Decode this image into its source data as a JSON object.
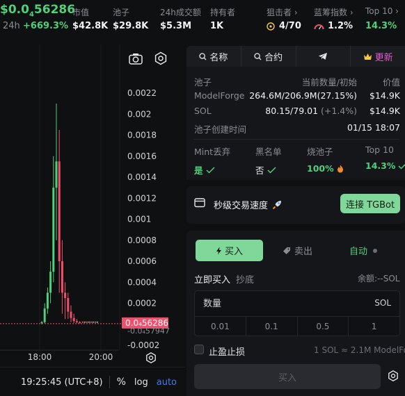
{
  "token": {
    "price_prefix": "$0.0",
    "price_sub": "4",
    "price_suffix": "56286",
    "change_label": "24h",
    "change_value": "+669.3%"
  },
  "stats": [
    {
      "label": "市值",
      "value": "$42.8K"
    },
    {
      "label": "池子",
      "value": "$29.8K"
    },
    {
      "label": "24h成交额",
      "value": "$5.3M"
    },
    {
      "label": "持有者",
      "value": "1K"
    },
    {
      "label": "狙击者",
      "value": "4/70"
    },
    {
      "label": "蓝筹指数",
      "value": "1.2%"
    },
    {
      "label": "Top 10",
      "value": "14.3%"
    }
  ],
  "chart": {
    "price_tag": "0.0₄56286",
    "price_tag_below": "-0.0₄57947",
    "time": "19:25:45 (UTC+8)",
    "percent_label": "%",
    "log_label": "log",
    "auto_label": "auto"
  },
  "chart_data": {
    "type": "candlestick",
    "yticks": [
      "0.0022",
      "0.002",
      "0.0018",
      "0.0016",
      "0.0014",
      "0.0012",
      "0.001",
      "0.0008",
      "0.0006",
      "0.0004",
      "0.0002",
      "-0.0002"
    ],
    "xticks": [
      "18:00",
      "20:00"
    ],
    "ylim": [
      -0.0002,
      0.0022
    ],
    "current_price": 5.6286e-06,
    "candles": [
      {
        "o": 1e-05,
        "h": 3e-05,
        "l": 0.0,
        "c": 2e-05
      },
      {
        "o": 2e-05,
        "h": 0.0002,
        "l": 1e-05,
        "c": 0.00015
      },
      {
        "o": 0.00015,
        "h": 0.00035,
        "l": 0.0001,
        "c": 0.0003
      },
      {
        "o": 0.0003,
        "h": 0.0006,
        "l": 0.0002,
        "c": 0.0005
      },
      {
        "o": 0.0005,
        "h": 0.0016,
        "l": 0.0004,
        "c": 0.0013
      },
      {
        "o": 0.0013,
        "h": 0.0021,
        "l": 0.0008,
        "c": 0.00155
      },
      {
        "o": 0.00155,
        "h": 0.00185,
        "l": 0.0003,
        "c": 0.0006
      },
      {
        "o": 0.0006,
        "h": 0.0008,
        "l": 0.0001,
        "c": 0.0003
      },
      {
        "o": 0.0003,
        "h": 0.0004,
        "l": 5e-05,
        "c": 0.00025
      },
      {
        "o": 0.00025,
        "h": 0.0003,
        "l": 5e-05,
        "c": 0.00012
      },
      {
        "o": 0.00012,
        "h": 0.00018,
        "l": 2e-05,
        "c": 6e-05
      },
      {
        "o": 6e-05,
        "h": 0.0001,
        "l": 1e-05,
        "c": 3e-05
      },
      {
        "o": 3e-05,
        "h": 5e-05,
        "l": 1e-05,
        "c": 2e-05
      },
      {
        "o": 2e-05,
        "h": 3e-05,
        "l": 1e-05,
        "c": 1e-05
      }
    ]
  },
  "tabs": {
    "name": "名称",
    "contract": "合约",
    "update": "更新"
  },
  "pool": {
    "header_pool": "池子",
    "header_amount": "当前数量/初始",
    "header_value": "价值",
    "rows": [
      {
        "name": "ModelForge",
        "amount": "264.6M/206.9M",
        "pct": "(27.15%)",
        "value": "$14.9K"
      },
      {
        "name": "SOL",
        "amount": "80.15/79.01",
        "pct": "(+1.4%)",
        "value": "$14.9K"
      }
    ],
    "created_label": "池子创建时间",
    "created_value": "01/15 18:07"
  },
  "security": {
    "mint_label": "Mint丢弃",
    "mint_value": "是",
    "blacklist_label": "黑名单",
    "blacklist_value": "否",
    "burn_label": "烧池子",
    "burn_value": "100%",
    "top10_label": "Top 10",
    "top10_value": "14.3%"
  },
  "speed": {
    "label": "秒级交易速度",
    "button": "连接 TGBot"
  },
  "trade": {
    "buy_tab": "买入",
    "sell_tab": "卖出",
    "auto_tab": "自动",
    "mode_instant": "立即买入",
    "mode_limit": "抄底",
    "balance": "余额:--SOL",
    "amount_placeholder": "数量",
    "unit": "SOL",
    "presets": [
      "0.01",
      "0.1",
      "0.5",
      "1"
    ],
    "stop_label": "止盈止损",
    "rate": "1 SOL ≈ 2.1M ModelFor",
    "submit": "买入"
  },
  "colors": {
    "up": "#4fd07a",
    "down": "#f0506e",
    "accent": "#7fd89a",
    "bg": "#0f1012",
    "panel": "#15161a"
  }
}
